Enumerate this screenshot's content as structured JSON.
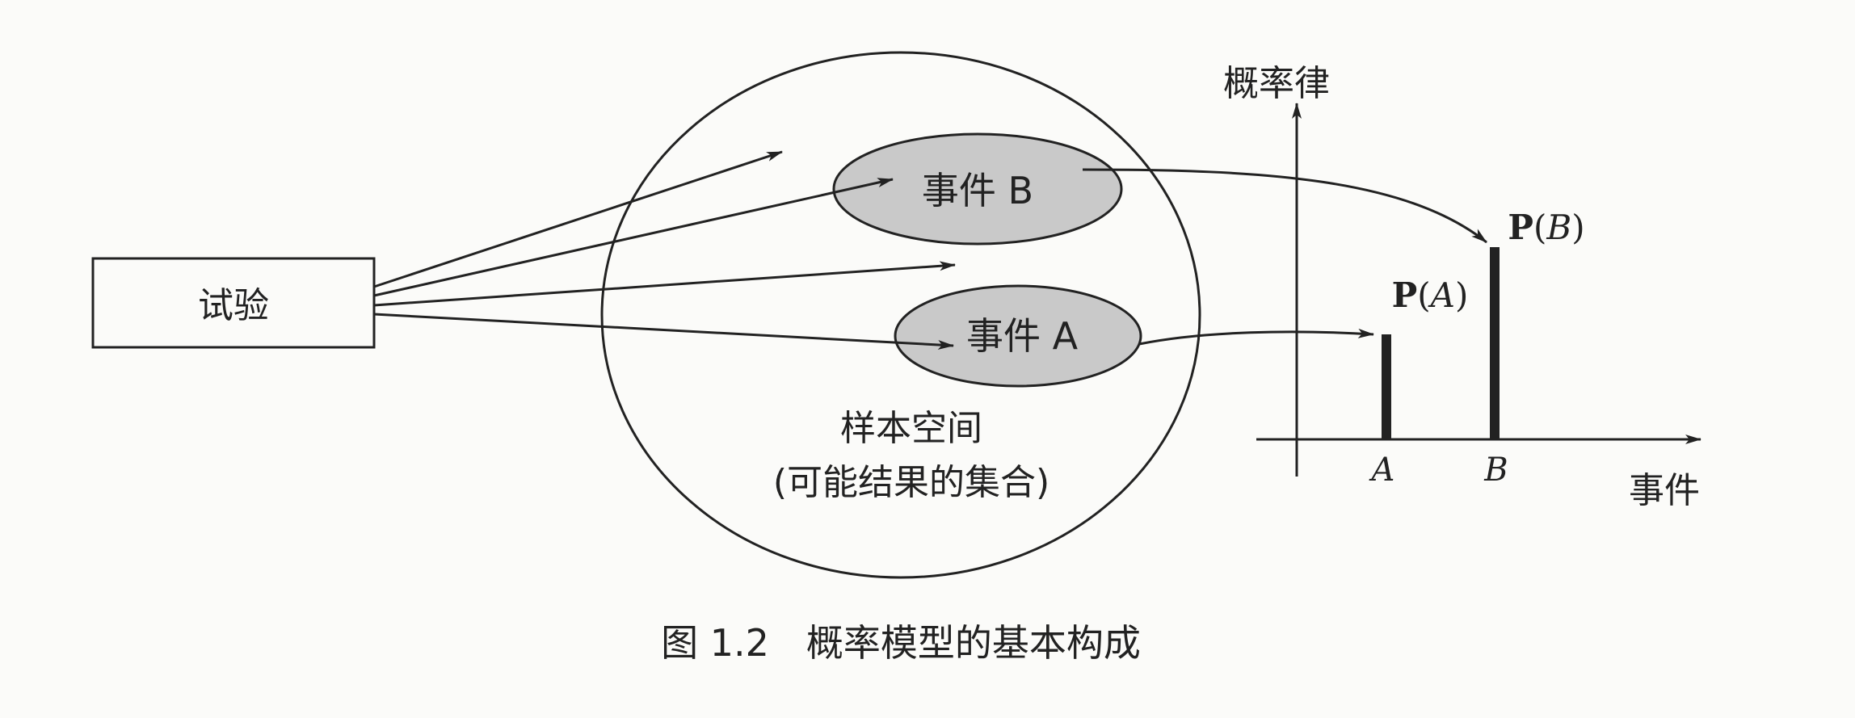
{
  "diagram": {
    "experiment_label": "试验",
    "sample_space": {
      "line1": "样本空间",
      "line2": "(可能结果的集合)"
    },
    "event_b_label": "事件 B",
    "event_a_label": "事件 A",
    "axis": {
      "y_label": "概率律",
      "x_label": "事件",
      "tick_a": "A",
      "tick_b": "B"
    },
    "prob_a": {
      "bold": "P",
      "arg": "A"
    },
    "prob_b": {
      "bold": "P",
      "arg": "B"
    },
    "caption": "图 1.2　概率模型的基本构成"
  },
  "colors": {
    "ink": "#222222",
    "event_fill": "#c9c9c9",
    "background": "#fbfbf9"
  }
}
